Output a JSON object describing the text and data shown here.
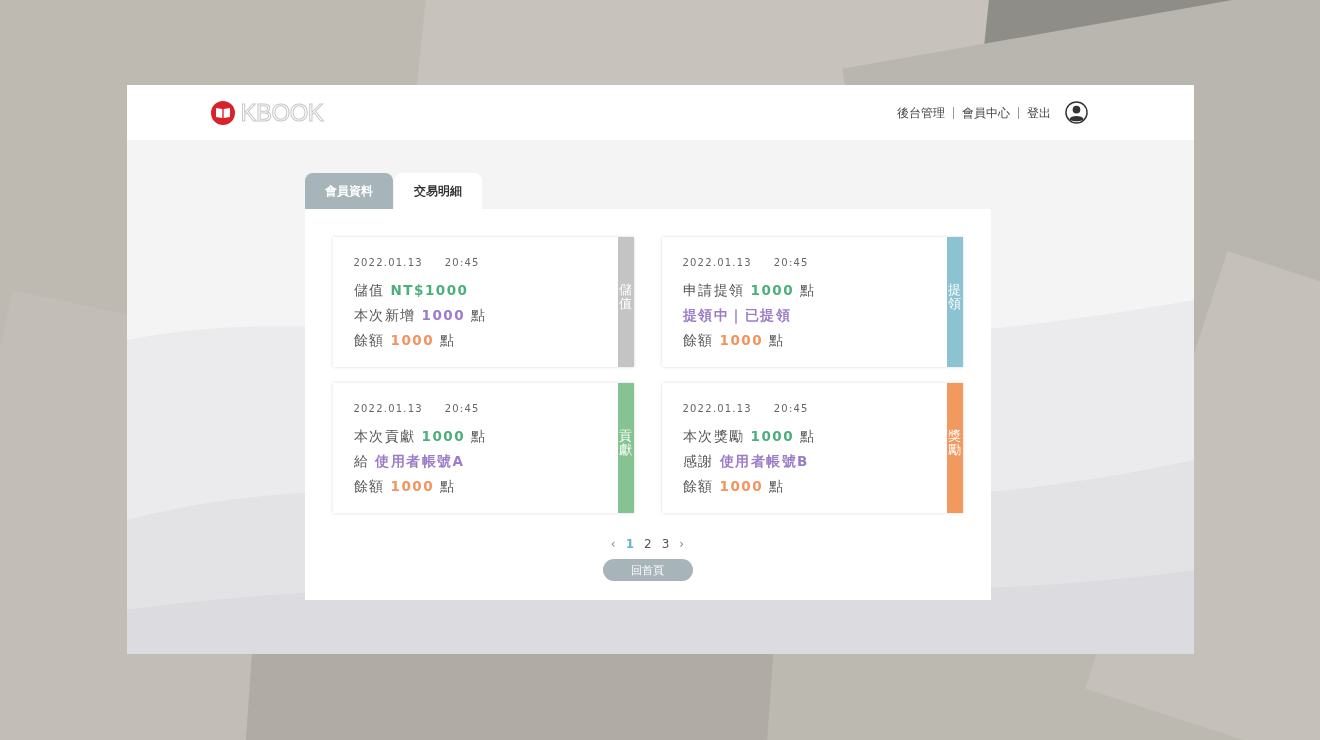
{
  "header": {
    "logo": "KBOOK",
    "links": [
      {
        "label": "後台管理"
      },
      {
        "label": "會員中心"
      },
      {
        "label": "登出"
      }
    ]
  },
  "tabs": [
    {
      "label": "會員資料",
      "selected": false
    },
    {
      "label": "交易明細",
      "selected": true
    }
  ],
  "records": [
    {
      "date": "2022.01.13",
      "time": "20:45",
      "tag": "儲值",
      "color": "#c4c4c4",
      "lines": [
        [
          {
            "text": "儲值",
            "color": "#555555"
          },
          {
            "text": "NT$1000",
            "color": "#4caf7d"
          }
        ],
        [
          {
            "text": "本次新增",
            "color": "#555555"
          },
          {
            "text": "1000",
            "color": "#9b7cc7"
          },
          {
            "text": "點",
            "color": "#555555"
          }
        ],
        [
          {
            "text": "餘額",
            "color": "#555555"
          },
          {
            "text": "1000",
            "color": "#f2945e"
          },
          {
            "text": "點",
            "color": "#555555"
          }
        ]
      ]
    },
    {
      "date": "2022.01.13",
      "time": "20:45",
      "tag": "提領",
      "color": "#8cc3d1",
      "lines": [
        [
          {
            "text": "申請提領",
            "color": "#555555"
          },
          {
            "text": "1000",
            "color": "#4caf7d"
          },
          {
            "text": "點",
            "color": "#555555"
          }
        ],
        [
          {
            "text": "提領中｜已提領",
            "color": "#9b7cc7"
          }
        ],
        [
          {
            "text": "餘額",
            "color": "#555555"
          },
          {
            "text": "1000",
            "color": "#f2945e"
          },
          {
            "text": "點",
            "color": "#555555"
          }
        ]
      ]
    },
    {
      "date": "2022.01.13",
      "time": "20:45",
      "tag": "貢獻",
      "color": "#86c392",
      "lines": [
        [
          {
            "text": "本次貢獻",
            "color": "#555555"
          },
          {
            "text": "1000",
            "color": "#4caf7d"
          },
          {
            "text": "點",
            "color": "#555555"
          }
        ],
        [
          {
            "text": "給",
            "color": "#555555"
          },
          {
            "text": "使用者帳號A",
            "color": "#9b7cc7"
          }
        ],
        [
          {
            "text": "餘額",
            "color": "#555555"
          },
          {
            "text": "1000",
            "color": "#f2945e"
          },
          {
            "text": "點",
            "color": "#555555"
          }
        ]
      ]
    },
    {
      "date": "2022.01.13",
      "time": "20:45",
      "tag": "獎勵",
      "color": "#f2995f",
      "lines": [
        [
          {
            "text": "本次獎勵",
            "color": "#555555"
          },
          {
            "text": "1000",
            "color": "#4caf7d"
          },
          {
            "text": "點",
            "color": "#555555"
          }
        ],
        [
          {
            "text": "感謝",
            "color": "#555555"
          },
          {
            "text": "使用者帳號B",
            "color": "#9b7cc7"
          }
        ],
        [
          {
            "text": "餘額",
            "color": "#555555"
          },
          {
            "text": "1000",
            "color": "#f2945e"
          },
          {
            "text": "點",
            "color": "#555555"
          }
        ]
      ]
    }
  ],
  "pagination": {
    "prev": "‹",
    "next": "›",
    "pages": [
      {
        "label": "1",
        "selected": true
      },
      {
        "label": "2",
        "selected": false
      },
      {
        "label": "3",
        "selected": false
      }
    ]
  },
  "home_button": "回首頁"
}
